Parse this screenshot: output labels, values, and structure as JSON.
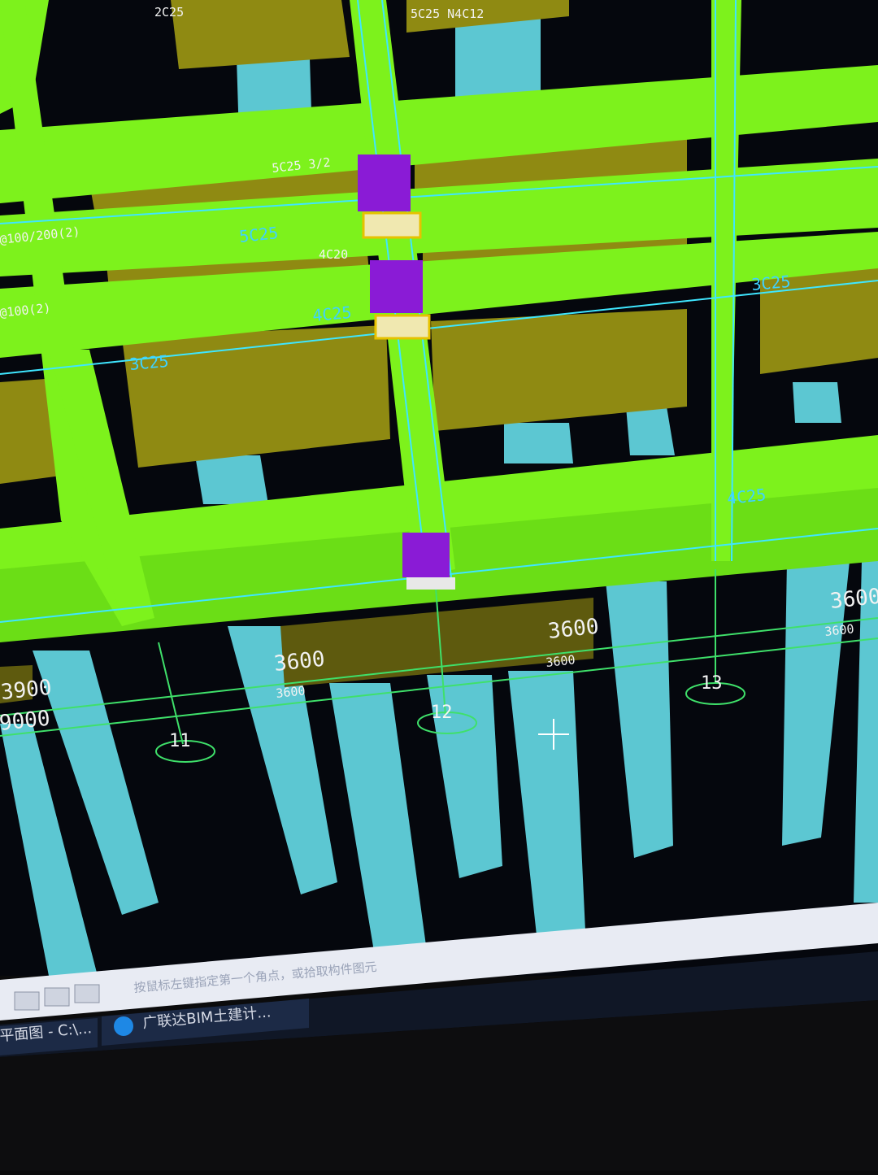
{
  "viewport": {
    "beam_labels": [
      "2C25",
      "5C25 N4C12",
      "5C25 3/2",
      "4C20",
      "4C25",
      "3C25",
      "5C25",
      "4C25",
      "3C25"
    ],
    "rebar_notes": [
      "@100/200(2)",
      "@100(2)"
    ],
    "dim_top": [
      "3600",
      "3600",
      "3600"
    ],
    "dim_sub": [
      "3600",
      "3600",
      "3600"
    ],
    "dim_left": [
      "3900",
      "9000"
    ],
    "axis_labels": [
      "11",
      "12",
      "13"
    ],
    "cursor": "crosshair",
    "colors": {
      "background": "#05070d",
      "beam": "#7df21c",
      "slab": "#8f8a12",
      "column": "#5cc7d2",
      "axis_line": "#3fe06a",
      "highlight": "#8a1bd6"
    }
  },
  "status_bar": {
    "prompt": "按鼠标左键指定第一个角点，或拾取构件图元"
  },
  "taskbar": {
    "items": [
      {
        "label": "平面图 - C:\\..."
      },
      {
        "label": "广联达BIM土建计..."
      }
    ]
  }
}
